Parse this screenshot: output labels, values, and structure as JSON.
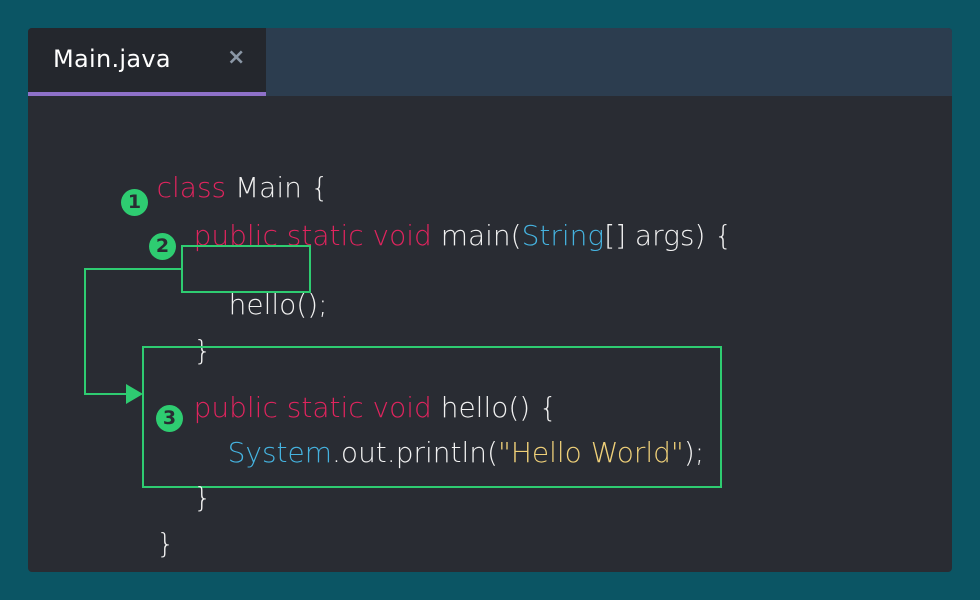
{
  "tab": {
    "label": "Main.java",
    "close_glyph": "×"
  },
  "code": {
    "line1": {
      "kw": "class",
      "rest": " Main {"
    },
    "line2": {
      "kw": "public static void",
      "mid": " main(",
      "type": "String",
      "rest": "[] args) {"
    },
    "line3": {
      "text": "hello();"
    },
    "line4": {
      "text": "}"
    },
    "line5": {
      "kw": "public static void",
      "rest": " hello() {"
    },
    "line6": {
      "type": "System",
      "mid": ".out.println(",
      "str": "\"Hello World\"",
      "rest": ");"
    },
    "line7": {
      "text": "}"
    },
    "line8": {
      "text": "}"
    }
  },
  "badges": {
    "one": "1",
    "two": "2",
    "three": "3"
  },
  "colors": {
    "background": "#0b5564",
    "editor": "#292c33",
    "tabbar": "#2c3d4f",
    "tab_active": "#24272d",
    "tab_underline": "#8e71c9",
    "keyword": "#e0245e",
    "type": "#45b3e0",
    "string": "#f0d179",
    "highlight": "#2ecc71"
  }
}
